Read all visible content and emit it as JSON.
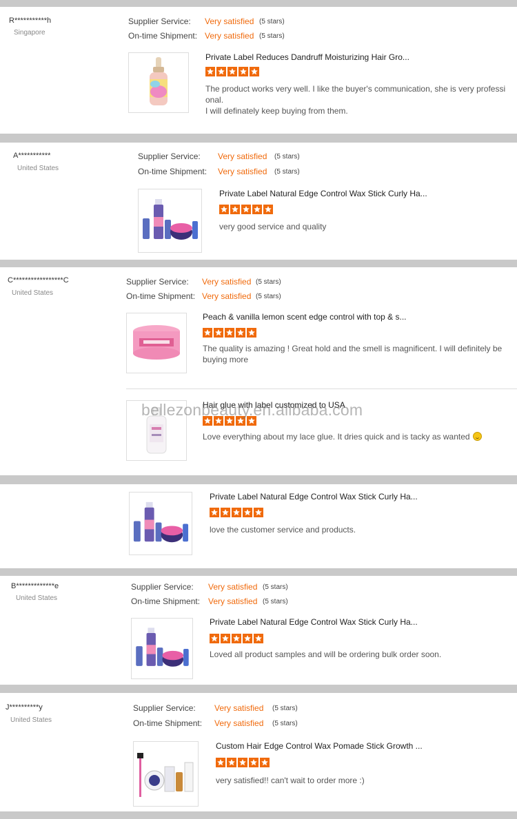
{
  "watermark": "bellezonbeauty.en.alibaba.com",
  "labels": {
    "supplier_service": "Supplier Service:",
    "on_time_shipment": "On-time Shipment:",
    "very_satisfied": "Very satisfied",
    "five_stars": "(5 stars)"
  },
  "colors": {
    "accent": "#f06a0c",
    "card": "#ffffff",
    "gap": "#c9c9c9"
  },
  "reviews": [
    {
      "reviewer": "R***********h",
      "country": "Singapore",
      "product_title": "Private Label Reduces Dandruff Moisturizing Hair Gro...",
      "rating": 5,
      "text_line1": "The product works very well. I like the buyer's communication, she is very professi",
      "text_line2": "onal.",
      "text_line3": "I will definately keep buying from them."
    },
    {
      "reviewer": "A***********",
      "country": "United States",
      "product_title": "Private Label Natural Edge Control Wax Stick Curly Ha...",
      "rating": 5,
      "text": "very good service and quality"
    },
    {
      "reviewer": "C*****************C",
      "country": "United States",
      "items": [
        {
          "product_title": "Peach & vanilla lemon scent edge control with top & s...",
          "rating": 5,
          "text_line1": "The quality is amazing ! Great hold and the smell is magnificent. I will definitely be",
          "text_line2": "buying more"
        },
        {
          "product_title": "Hair glue with label customized to USA",
          "rating": 5,
          "text": "Love everything about my lace glue. It dries quick and is tacky as wanted"
        }
      ]
    },
    {
      "product_title": "Private Label Natural Edge Control Wax Stick Curly Ha...",
      "rating": 5,
      "text": "love the customer service and products."
    },
    {
      "reviewer": "B*************e",
      "country": "United States",
      "product_title": "Private Label Natural Edge Control Wax Stick Curly Ha...",
      "rating": 5,
      "text": "Loved all product samples and will be ordering bulk order soon."
    },
    {
      "reviewer": "J**********y",
      "country": "United States",
      "product_title": "Custom Hair Edge Control Wax Pomade Stick Growth ...",
      "rating": 5,
      "text": "very satisfied!! can't wait to order more :)"
    }
  ]
}
